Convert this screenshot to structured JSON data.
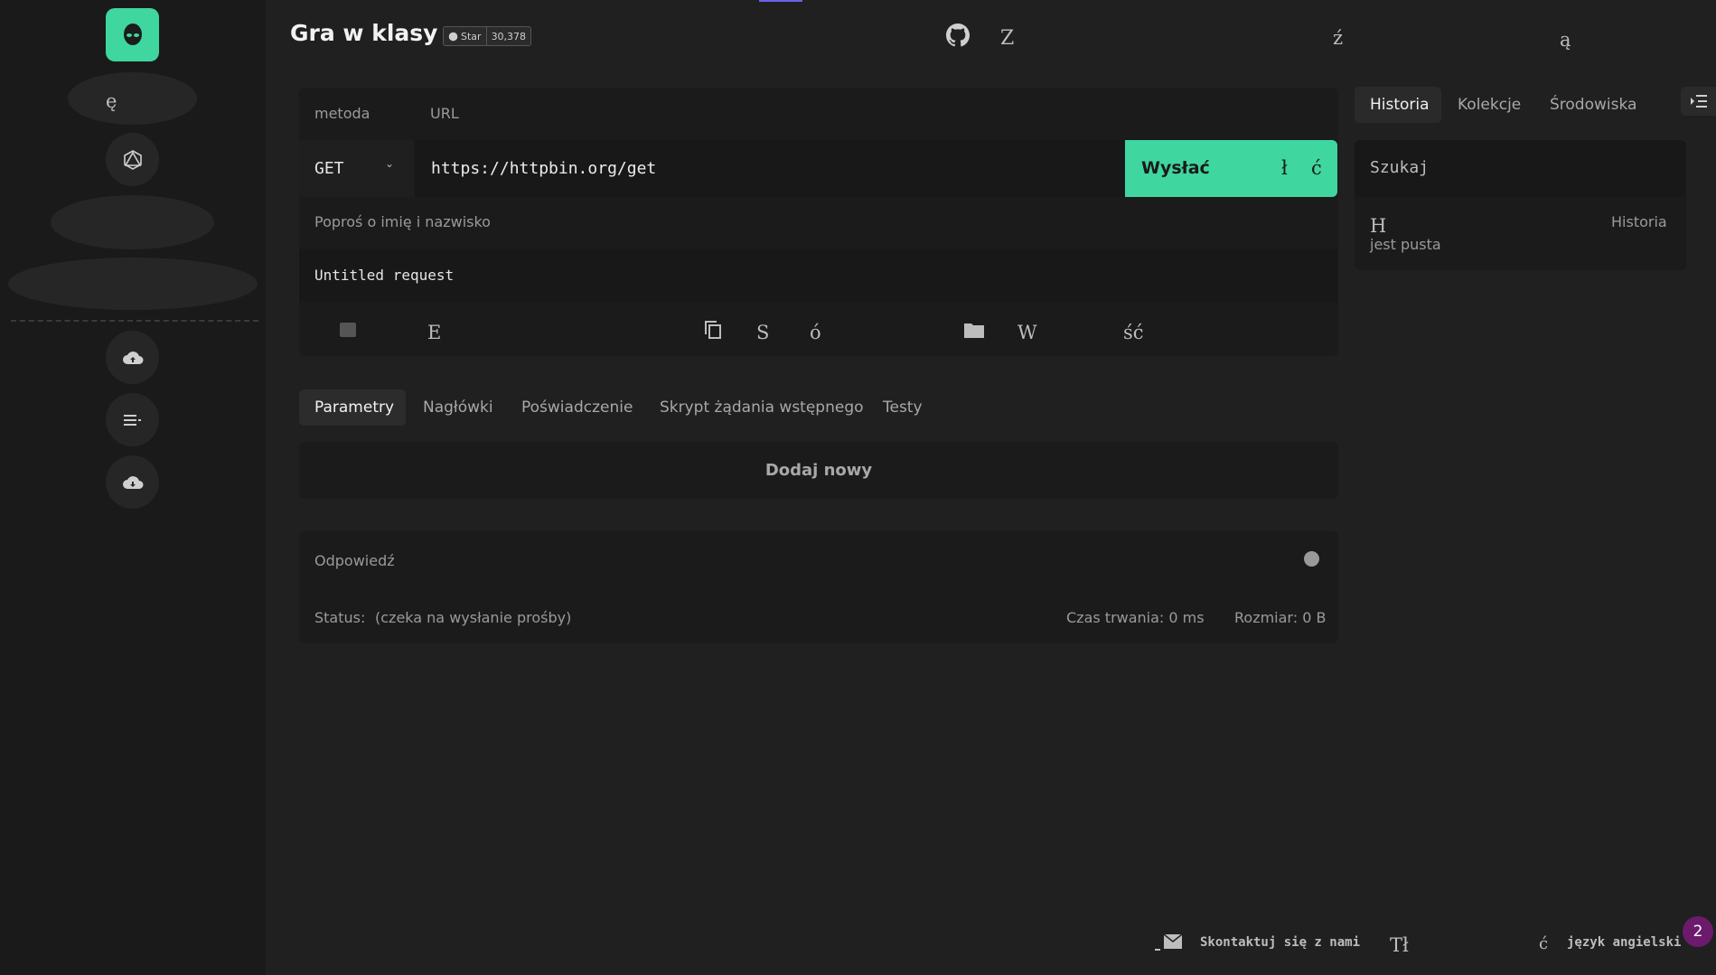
{
  "header": {
    "title": "Gra w klasy",
    "github_star_label": "Star",
    "github_star_count": "30,378",
    "glyph_z": "Z",
    "glyph_z2": "ź",
    "glyph_a": "ą"
  },
  "sidebar": {
    "glyph_e": "ę",
    "items": [
      "rest",
      "graphql",
      "realtime",
      "docs",
      "upload",
      "menu",
      "download"
    ]
  },
  "request": {
    "method_label": "metoda",
    "url_label": "URL",
    "method_value": "GET",
    "url_value": "https://httpbin.org/get",
    "send_label": "Wysłać",
    "send_glyph1": "ł",
    "send_glyph2": "ć",
    "name_label": "Poproś o imię i nazwisko",
    "name_value": "Untitled request",
    "actions": {
      "markdown_glyph": "E",
      "copy_glyph1": "S",
      "copy_glyph2": "ó",
      "save_glyph1": "W",
      "save_glyph2": "ść"
    }
  },
  "tabs": [
    "Parametry",
    "Nagłówki",
    "Poświadczenie",
    "Skrypt żądania wstępnego",
    "Testy"
  ],
  "params": {
    "add_new": "Dodaj nowy"
  },
  "response": {
    "title": "Odpowiedź",
    "status_label": "Status:",
    "status_value": "(czeka na wysłanie prośby)",
    "duration": "Czas trwania: 0 ms",
    "size": "Rozmiar: 0 B"
  },
  "history": {
    "tabs": [
      "Historia",
      "Kolekcje",
      "Środowiska"
    ],
    "search_placeholder": "Szukaj",
    "empty_glyph": "H",
    "empty_word": "Historia",
    "empty_text": "jest pusta"
  },
  "footer": {
    "contact": "Skontaktuj się z nami",
    "glyph_t": "Tł",
    "glyph_c": "ć",
    "language": "język angielski",
    "notif_count": "2"
  },
  "colors": {
    "accent": "#3fd6a0",
    "background": "#202020",
    "sidebar": "#1a1a1a",
    "badge": "#6c1b6c"
  }
}
